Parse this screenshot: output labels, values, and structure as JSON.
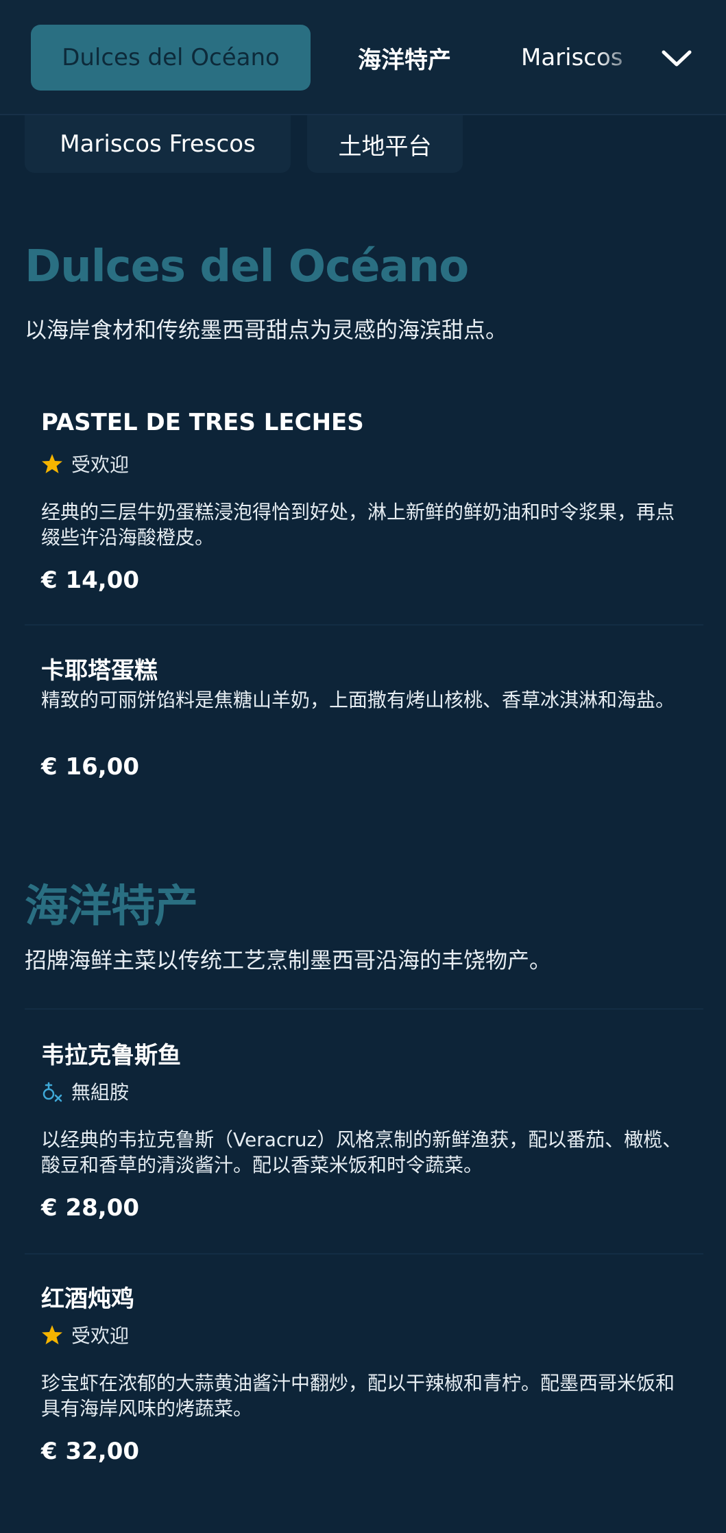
{
  "nav": {
    "tabs": [
      {
        "label": "Dulces del Océano",
        "active": true
      },
      {
        "label": "海洋特产",
        "active": false
      },
      {
        "label": "Mariscos",
        "active": false
      }
    ],
    "chips": [
      {
        "label": "Mariscos Frescos"
      },
      {
        "label": "土地平台"
      }
    ],
    "expand_icon": "chevron-down-icon"
  },
  "sections": [
    {
      "title": "Dulces del Océano",
      "description": "以海岸食材和传统墨西哥甜点为灵感的海滨甜点。",
      "items": [
        {
          "name": "PASTEL DE TRES LECHES",
          "badge": {
            "icon": "star-icon",
            "label": "受欢迎"
          },
          "description": "经典的三层牛奶蛋糕浸泡得恰到好处，淋上新鲜的鲜奶油和时令浆果，再点缀些许沿海酸橙皮。",
          "price": "€ 14,00"
        },
        {
          "name": "卡耶塔蛋糕",
          "badge": null,
          "description": "精致的可丽饼馅料是焦糖山羊奶，上面撒有烤山核桃、香草冰淇淋和海盐。",
          "price": "€ 16,00"
        }
      ]
    },
    {
      "title": "海洋特产",
      "description": "招牌海鲜主菜以传统工艺烹制墨西哥沿海的丰饶物产。",
      "items": [
        {
          "name": "韦拉克鲁斯鱼",
          "badge": {
            "icon": "histamine-free-icon",
            "label": "無組胺"
          },
          "description": "以经典的韦拉克鲁斯（Veracruz）风格烹制的新鲜渔获，配以番茄、橄榄、酸豆和香草的清淡酱汁。配以香菜米饭和时令蔬菜。",
          "price": "€ 28,00"
        },
        {
          "name": "红酒炖鸡",
          "badge": {
            "icon": "star-icon",
            "label": "受欢迎"
          },
          "description": "珍宝虾在浓郁的大蒜黄油酱汁中翻炒，配以干辣椒和青柠。配墨西哥米饭和具有海岸风味的烤蔬菜。",
          "price": "€ 32,00"
        }
      ]
    }
  ],
  "colors": {
    "background": "#0d2438",
    "accent": "#2a6f82",
    "star": "#f5b400",
    "badge_icon": "#3fa9d8"
  }
}
